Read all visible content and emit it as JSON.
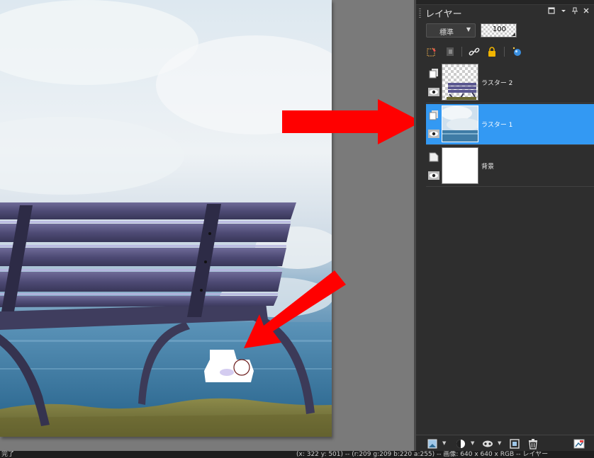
{
  "layers_panel": {
    "title": "レイヤー",
    "blend_mode": "標準",
    "opacity": "100",
    "layers": [
      {
        "name": "ラスター 2",
        "selected": false,
        "visible": true,
        "kind": "raster-transparent"
      },
      {
        "name": "ラスター 1",
        "selected": true,
        "visible": true,
        "kind": "raster-sky"
      },
      {
        "name": "背景",
        "selected": false,
        "visible": true,
        "kind": "background-white"
      }
    ]
  },
  "status_bar": {
    "left_text": "完了",
    "right_text": "(x: 322 y: 501) -- (r:209 g:209 b:220 a:255) -- 画像: 640 x 640 x RGB -- レイヤー"
  },
  "colors": {
    "panel_bg": "#2e2e2e",
    "selected_row": "#3399f3",
    "canvas_bg": "#7a7a7a",
    "annotation_arrow": "#ff0000"
  },
  "icons": {
    "header": [
      "maximize-icon",
      "menu-arrow-icon",
      "pin-icon",
      "close-icon"
    ],
    "toolbar": [
      "edit-selection-icon",
      "mask-icon",
      "link-icon",
      "lock-icon",
      "layer-effects-icon"
    ],
    "bottom": [
      "new-layer-icon",
      "adjustment-layer-icon",
      "mask-layer-icon",
      "duplicate-layer-icon",
      "delete-layer-icon",
      "layer-properties-icon"
    ]
  }
}
